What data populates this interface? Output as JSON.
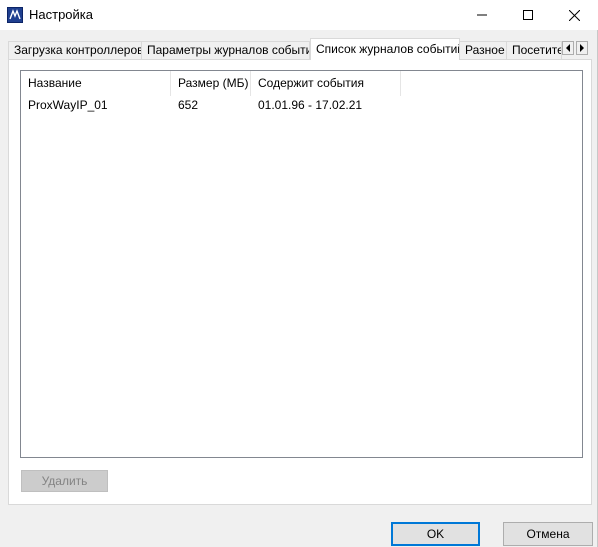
{
  "window": {
    "title": "Настройка",
    "icon": "app-icon",
    "controls": {
      "minimize_icon": "minimize-icon",
      "maximize_icon": "maximize-icon",
      "close_icon": "close-icon"
    }
  },
  "tabs": [
    {
      "label": "Загрузка контроллеров",
      "active": false
    },
    {
      "label": "Параметры журналов событий",
      "active": false
    },
    {
      "label": "Список журналов событий",
      "active": true
    },
    {
      "label": "Разное",
      "active": false
    },
    {
      "label": "Посетите",
      "active": false
    }
  ],
  "tab_scroll": {
    "left_icon": "scroll-left-icon",
    "right_icon": "scroll-right-icon"
  },
  "list": {
    "columns": [
      "Название",
      "Размер (МБ)",
      "Содержит события"
    ],
    "rows": [
      {
        "name": "ProxWayIP_01",
        "size": "652",
        "events": "01.01.96 - 17.02.21"
      }
    ]
  },
  "buttons": {
    "delete": "Удалить",
    "ok": "OK",
    "cancel": "Отмена"
  },
  "colors": {
    "accent": "#0078d7",
    "window_bg": "#f0f0f0",
    "disabled_text": "#838383"
  }
}
